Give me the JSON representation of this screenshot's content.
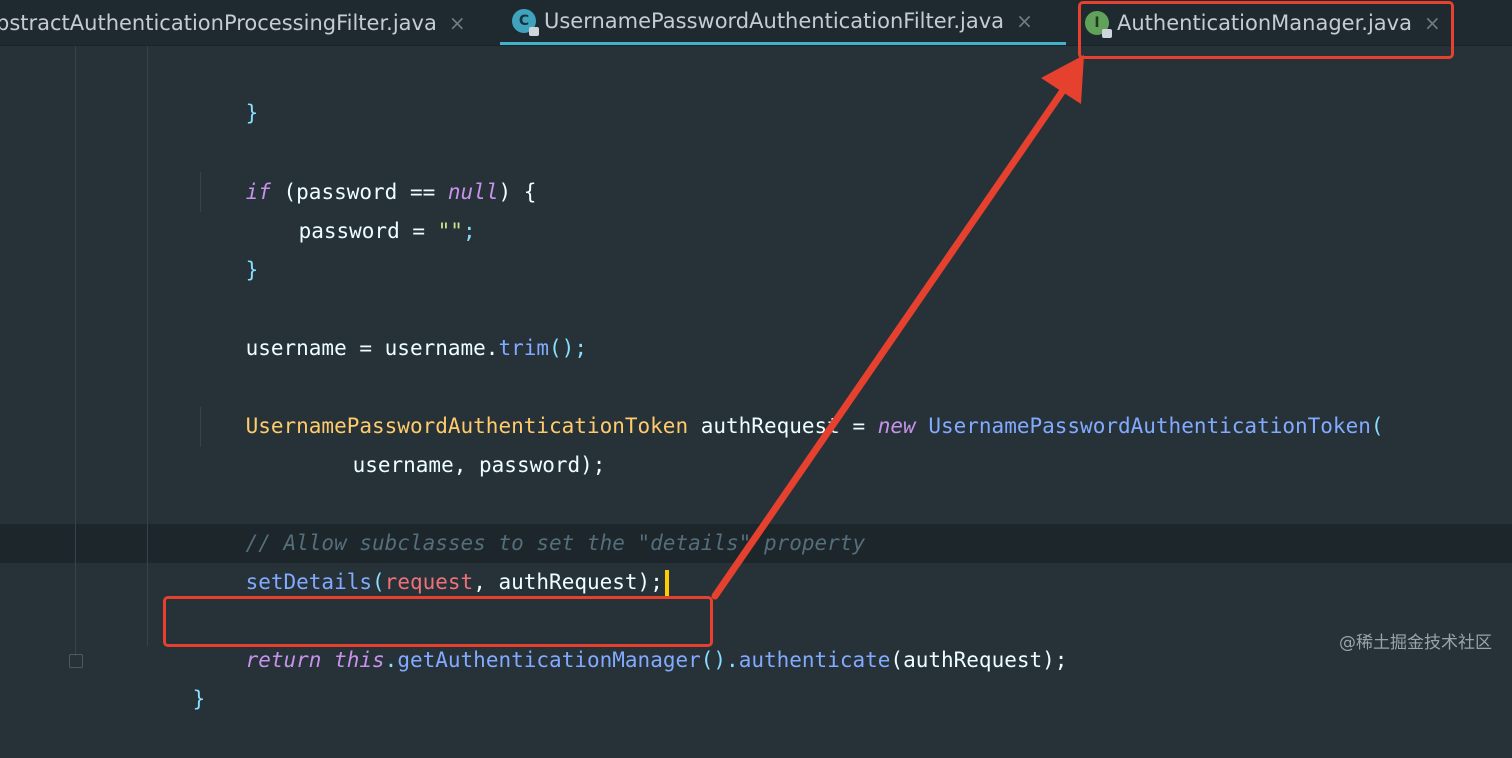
{
  "tabs": [
    {
      "label": "bstractAuthenticationProcessingFilter.java",
      "close": "×",
      "icon": null
    },
    {
      "label": "UsernamePasswordAuthenticationFilter.java",
      "close": "×",
      "icon": "class-icon",
      "icon_letter": "C"
    },
    {
      "label": "AuthenticationManager.java",
      "close": "×",
      "icon": "interface-icon",
      "icon_letter": "I"
    }
  ],
  "code": {
    "l1": "}",
    "l2": {
      "kw_if": "if",
      "a": " (password == ",
      "null": "null",
      "b": ") {"
    },
    "l3": {
      "a": "password = ",
      "str": "\"\"",
      "b": ";"
    },
    "l4": "}",
    "l5": {
      "a": "username = username.",
      "fn": "trim",
      "b": "();"
    },
    "l6": {
      "type": "UsernamePasswordAuthenticationToken",
      "a": " authRequest = ",
      "kw_new": "new",
      "sp": " ",
      "ctor": "UsernamePasswordAuthenticationToken",
      "b": "("
    },
    "l7": "username, password);",
    "l8": "// Allow subclasses to set the \"details\" property",
    "l9": {
      "fn": "setDetails",
      "a": "(",
      "param": "request",
      "b": ", authRequest);"
    },
    "l10": {
      "kw_return": "return",
      "sp": " ",
      "kw_this": "this",
      "dot": ".",
      "fn1": "getAuthenticationManager",
      "a": "().",
      "fn2": "authenticate",
      "b": "(authRequest);"
    },
    "l11": "}"
  },
  "watermark": "@稀土掘金技术社区",
  "colors": {
    "annotation": "#e5412e",
    "caret": "#ffcc00",
    "active_tab_underline": "#43b3c9"
  }
}
